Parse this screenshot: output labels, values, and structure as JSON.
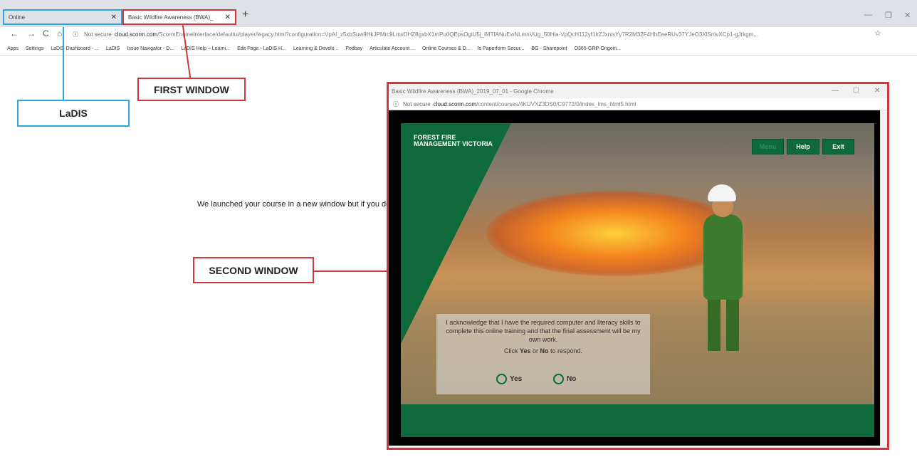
{
  "tabs": [
    {
      "label": "Online",
      "close": "✕"
    },
    {
      "label": "Basic Wildfire Awareness (BWA)_",
      "close": "✕"
    }
  ],
  "new_tab": "+",
  "window_controls": [
    "—",
    "❐",
    "✕"
  ],
  "nav": {
    "back": "←",
    "forward": "→",
    "reload": "C",
    "home": "⌂"
  },
  "address": {
    "info": "ⓘ",
    "not_secure": "Not secure",
    "domain": "cloud.scorm.com",
    "path": "/ScormEngineInterface/defaultui/player/legacy.html?configuration=VpAI_z5xbSuw9HkJPMrc9LmvDHZ8gxbX1mPu0QEpsOgiU5j_iMTfANuEwNLmnVUg_50Hla-VpQcH112yf1lrZJxnisYy7R2M32F4HhEeeRUv37YJeO3XlSmvXCp1-gJrkgm..."
  },
  "bookmarks": [
    "Apps",
    "Settings",
    "LaDIS Dashboard - ...",
    "LaDIS",
    "Issue Navigator - D...",
    "LaDIS Help – Learni...",
    "Edit Page › LaDIS H...",
    "Learning & Develo...",
    "Podbay",
    "Articulate Account ...",
    "Online Courses & D...",
    "Is Paperform Secur...",
    "BG - Sharepoint",
    "O365-GRP-Ongoin..."
  ],
  "page_text": "We launched your course in a new window but if you do",
  "annotations": {
    "ladis": "LaDIS",
    "first_window": "FIRST WINDOW",
    "second_window": "SECOND WINDOW",
    "colors": {
      "blue": "#2aa7dc",
      "red": "#d4343a"
    }
  },
  "second_window": {
    "title": "Basic Wildfire Awareness (BWA)_2019_07_01 - Google Chrome",
    "address_info": "ⓘ",
    "not_secure": "Not secure",
    "domain": "cloud.scorm.com",
    "path": "/content/courses/4KUVXZ3DS0/C9772/0/index_lms_html5.html",
    "controls": [
      "—",
      "☐",
      "✕"
    ]
  },
  "course": {
    "logo_line1": "FOREST FIRE",
    "logo_line2": "MANAGEMENT VICTORIA",
    "buttons": {
      "menu": "Menu",
      "help": "Help",
      "exit": "Exit"
    },
    "question": "I acknowledge that I have the required computer and literacy skills to complete this online training and that the final assessment will be my own work.",
    "click_prefix": "Click ",
    "click_yes": "Yes",
    "click_mid": " or ",
    "click_no": "No",
    "click_suffix": " to respond.",
    "options": {
      "yes": "Yes",
      "no": "No"
    },
    "brand_green": "#0e6a3b"
  }
}
